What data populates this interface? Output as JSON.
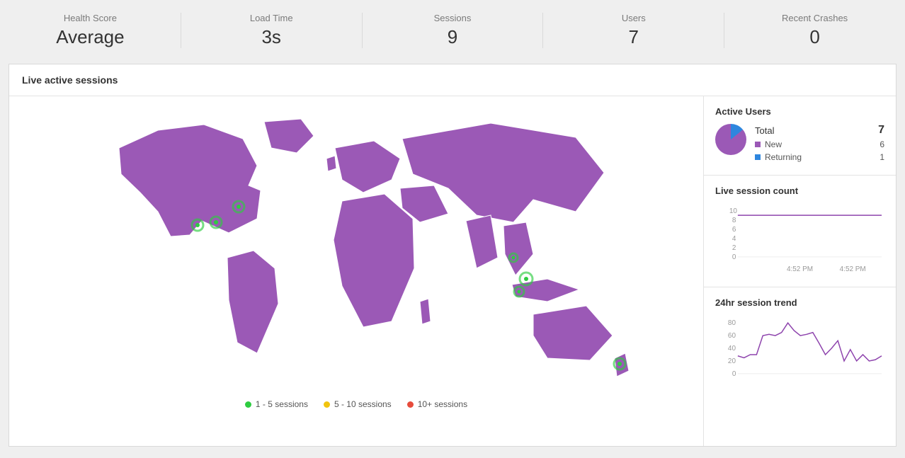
{
  "metrics": [
    {
      "label": "Health Score",
      "value": "Average"
    },
    {
      "label": "Load Time",
      "value": "3s"
    },
    {
      "label": "Sessions",
      "value": "9"
    },
    {
      "label": "Users",
      "value": "7"
    },
    {
      "label": "Recent Crashes",
      "value": "0"
    }
  ],
  "panel": {
    "title": "Live active sessions",
    "map_legend": [
      {
        "label": "1 - 5 sessions",
        "color": "#2ecc40"
      },
      {
        "label": "5 - 10 sessions",
        "color": "#f1c40f"
      },
      {
        "label": "10+ sessions",
        "color": "#e74c3c"
      }
    ]
  },
  "active_users": {
    "title": "Active Users",
    "total_label": "Total",
    "total_value": "7",
    "rows": [
      {
        "label": "New",
        "value": "6",
        "color": "#9b59b6"
      },
      {
        "label": "Returning",
        "value": "1",
        "color": "#2e86de"
      }
    ]
  },
  "live_count": {
    "title": "Live session count"
  },
  "trend": {
    "title": "24hr session trend"
  },
  "chart_data": [
    {
      "type": "pie",
      "title": "Active Users",
      "series": [
        {
          "name": "New",
          "values": [
            6
          ],
          "color": "#9b59b6"
        },
        {
          "name": "Returning",
          "values": [
            1
          ],
          "color": "#2e86de"
        }
      ]
    },
    {
      "type": "line",
      "title": "Live session count",
      "x": [
        "4:52 PM",
        "4:52 PM"
      ],
      "series": [
        {
          "name": "sessions",
          "values": [
            9,
            9
          ]
        }
      ],
      "ylim": [
        0,
        10
      ],
      "yticks": [
        0,
        2,
        4,
        6,
        8,
        10
      ],
      "xlabel": "",
      "ylabel": ""
    },
    {
      "type": "line",
      "title": "24hr session trend",
      "x_index": [
        0,
        1,
        2,
        3,
        4,
        5,
        6,
        7,
        8,
        9,
        10,
        11,
        12,
        13,
        14,
        15,
        16,
        17,
        18,
        19,
        20,
        21,
        22,
        23
      ],
      "series": [
        {
          "name": "sessions",
          "values": [
            28,
            25,
            30,
            30,
            60,
            62,
            60,
            65,
            80,
            68,
            60,
            62,
            65,
            48,
            30,
            40,
            52,
            20,
            38,
            20,
            30,
            20,
            22,
            28
          ]
        }
      ],
      "ylim": [
        0,
        80
      ],
      "yticks": [
        0,
        20,
        40,
        60,
        80
      ],
      "xlabel": "",
      "ylabel": ""
    }
  ]
}
